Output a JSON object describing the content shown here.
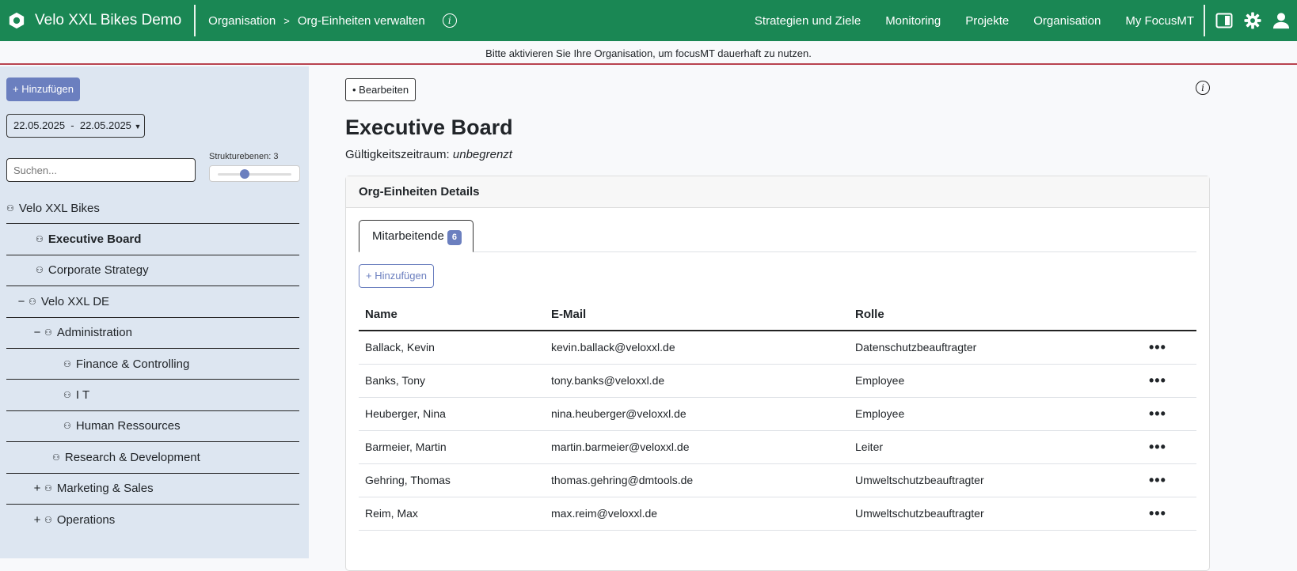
{
  "header": {
    "app_title": "Velo XXL Bikes Demo",
    "breadcrumb": [
      "Organisation",
      ">",
      "Org-Einheiten verwalten"
    ],
    "nav": [
      "Strategien und Ziele",
      "Monitoring",
      "Projekte",
      "Organisation",
      "My FocusMT"
    ],
    "brand_color": "#1a8754"
  },
  "notice": "Bitte aktivieren Sie Ihre Organisation, um focusMT dauerhaft zu nutzen.",
  "sidebar": {
    "add_label": "+ Hinzufügen",
    "date_range": "22.05.2025  -  22.05.2025",
    "search_placeholder": "Suchen...",
    "levels_label": "Strukturebenen: 3",
    "levels_value": 3,
    "tree": [
      {
        "label": "Velo XXL Bikes",
        "toggle": "",
        "level": 0
      },
      {
        "label": "Executive Board",
        "toggle": "",
        "level": 2,
        "selected": true
      },
      {
        "label": "Corporate Strategy",
        "toggle": "",
        "level": 2
      },
      {
        "label": "Velo XXL DE",
        "toggle": "−",
        "level": 1
      },
      {
        "label": "Administration",
        "toggle": "−",
        "level": 2
      },
      {
        "label": "Finance & Controlling",
        "toggle": "",
        "level": 4
      },
      {
        "label": "I T",
        "toggle": "",
        "level": 4
      },
      {
        "label": "Human Ressources",
        "toggle": "",
        "level": 4
      },
      {
        "label": "Research & Development",
        "toggle": "",
        "level": 3
      },
      {
        "label": "Marketing & Sales",
        "toggle": "+",
        "level": 2
      },
      {
        "label": "Operations",
        "toggle": "+",
        "level": 2
      }
    ]
  },
  "main": {
    "edit_label": "• Bearbeiten",
    "title": "Executive Board",
    "validity_label": "Gültigkeitszeitraum:",
    "validity_value": "unbegrenzt",
    "card_title": "Org-Einheiten Details",
    "tab_label": "Mitarbeitende",
    "tab_count": "6",
    "add_label": "+ Hinzufügen",
    "columns": [
      "Name",
      "E-Mail",
      "Rolle"
    ],
    "rows": [
      [
        "Ballack, Kevin",
        "kevin.ballack@veloxxl.de",
        "Datenschutzbeauftragter"
      ],
      [
        "Banks, Tony",
        "tony.banks@veloxxl.de",
        "Employee"
      ],
      [
        "Heuberger, Nina",
        "nina.heuberger@veloxxl.de",
        "Employee"
      ],
      [
        "Barmeier, Martin",
        "martin.barmeier@veloxxl.de",
        "Leiter"
      ],
      [
        "Gehring, Thomas",
        "thomas.gehring@dmtools.de",
        "Umweltschutzbeauftragter"
      ],
      [
        "Reim, Max",
        "max.reim@veloxxl.de",
        "Umweltschutzbeauftragter"
      ]
    ],
    "row_menu": "•••"
  }
}
